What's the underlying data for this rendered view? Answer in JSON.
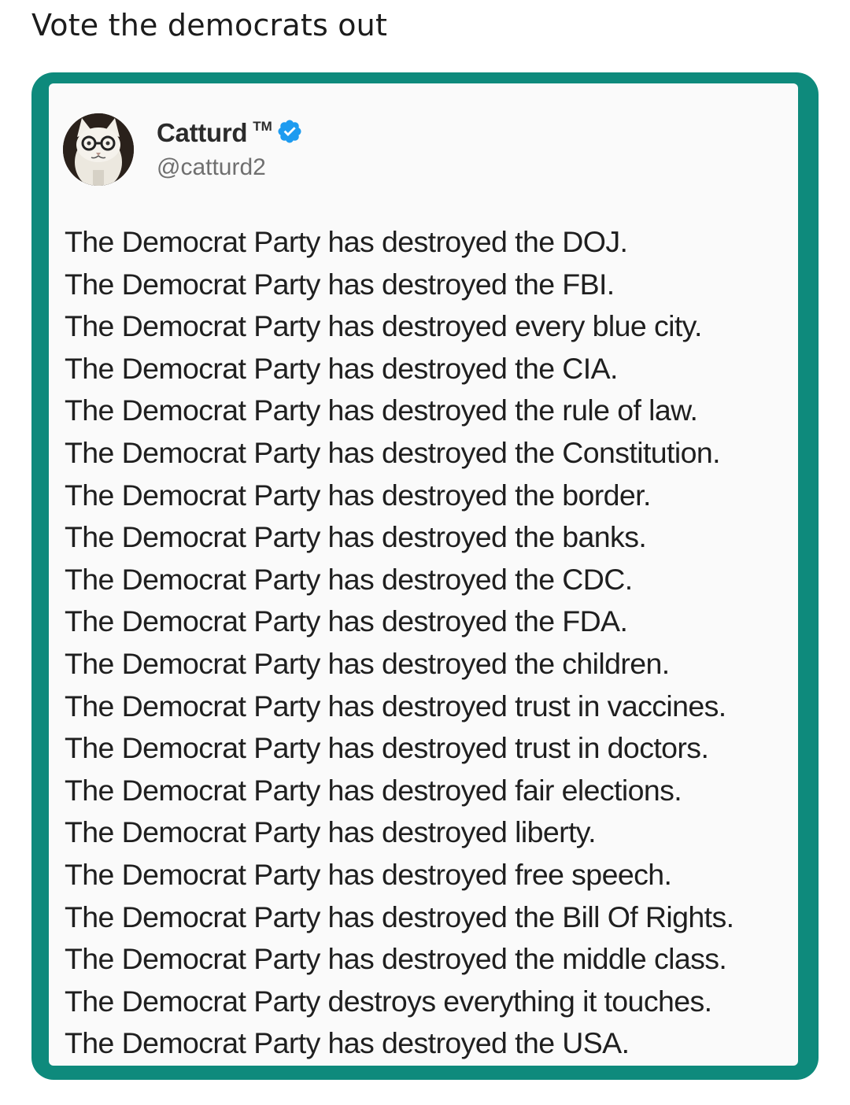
{
  "post": {
    "caption": "Vote the democrats out"
  },
  "tweet": {
    "display_name": "Catturd",
    "trademark": "TM",
    "handle": "@catturd2",
    "avatar_icon": "cat-with-glasses-icon",
    "verified_icon": "verified-badge-icon",
    "lines": [
      "The Democrat Party has destroyed the DOJ.",
      "The Democrat Party has destroyed the FBI.",
      "The Democrat Party has destroyed every blue city.",
      "The Democrat Party has destroyed the CIA.",
      "The Democrat Party has destroyed the rule of law.",
      "The Democrat Party has destroyed the Constitution.",
      "The Democrat Party has destroyed the border.",
      "The Democrat Party has destroyed the banks.",
      "The Democrat Party has destroyed the CDC.",
      "The Democrat Party has destroyed the FDA.",
      "The Democrat Party has destroyed the children.",
      "The Democrat Party has destroyed trust in vaccines.",
      "The Democrat Party has destroyed trust in doctors.",
      "The Democrat Party has destroyed fair elections.",
      "The Democrat Party has destroyed liberty.",
      "The Democrat Party has destroyed free speech.",
      "The Democrat Party has destroyed the Bill Of Rights.",
      "The Democrat Party has destroyed the middle class.",
      "The Democrat Party destroys everything it touches.",
      "The Democrat Party has destroyed the USA."
    ]
  },
  "colors": {
    "frame": "#0e8a7c",
    "verified": "#1d9bf0",
    "text": "#1f1f1f",
    "handle": "#6f6f6f"
  }
}
